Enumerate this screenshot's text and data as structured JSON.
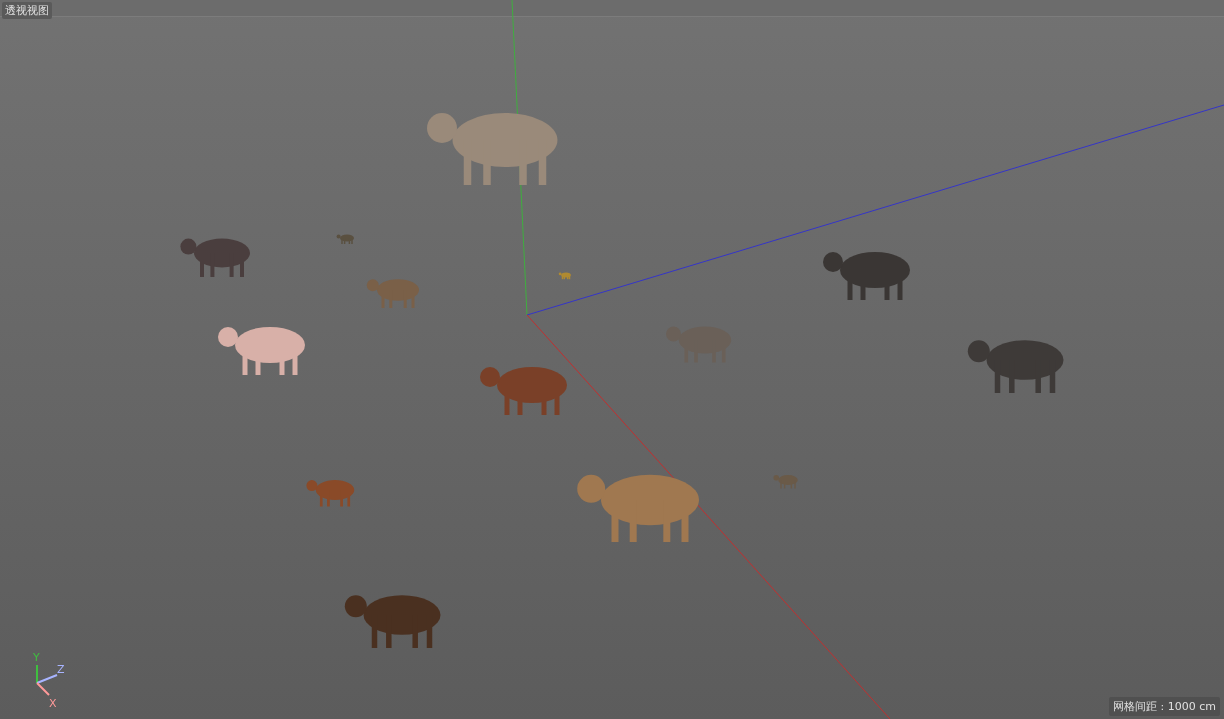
{
  "viewport": {
    "title": "透视视图",
    "grid_spacing": "网格间距 : 1000 cm"
  },
  "axis_gizmo": [
    {
      "kind": "y",
      "label": "Y"
    },
    {
      "kind": "z",
      "label": "Z"
    },
    {
      "kind": "x",
      "label": "X"
    }
  ]
}
